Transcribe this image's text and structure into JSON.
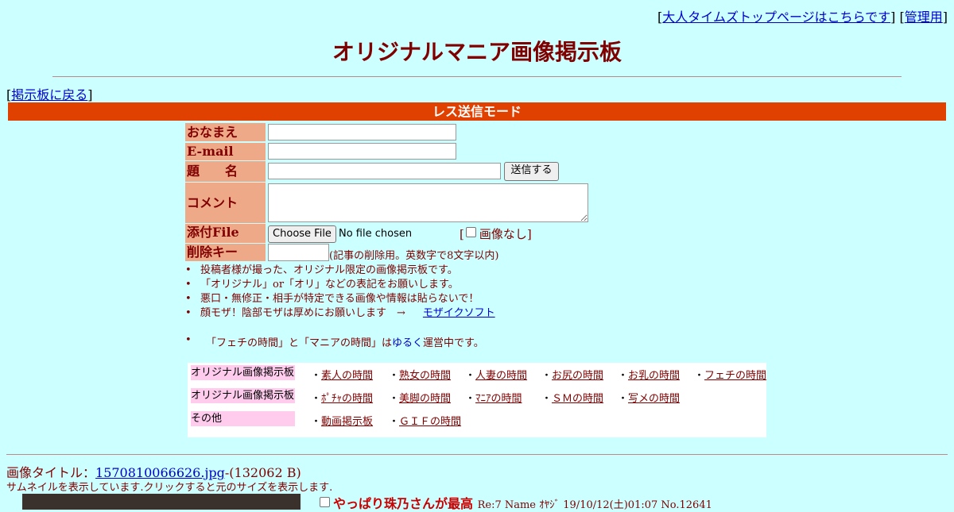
{
  "top_links": {
    "top_page": "大人タイムズトップページはこちらです",
    "admin": "管理用"
  },
  "page_title": "オリジナルマニア画像掲示板",
  "back_link": "掲示板に戻る",
  "mode_bar": "レス送信モード",
  "form": {
    "name_label": "おなまえ",
    "email_label": "E-mail",
    "subject_label": "題　　名",
    "submit_label": "送信する",
    "comment_label": "コメント",
    "file_label": "添付File",
    "choose_file_label": "Choose File",
    "no_file_text": "No file chosen",
    "no_image_label": "画像なし",
    "delete_key_label": "削除キー",
    "delete_key_note": "(記事の削除用。英数字で8文字以内)"
  },
  "notes": [
    "投稿者様が撮った、オリジナル限定の画像掲示板です。",
    "「オリジナル」or「オリ」などの表記をお願いします。",
    "悪口・無修正・相手が特定できる画像や情報は貼らないで！",
    "顔モザ！陰部モザは厚めにお願いします　→"
  ],
  "mosaic_link": "モザイクソフト",
  "operation_note": {
    "pre": "「フェチの時間」と「マニアの時間」は",
    "link": "ゆるく",
    "post": "運営中です。"
  },
  "nav": [
    {
      "head": "オリジナル画像掲示板",
      "links": [
        "素人の時間",
        "熟女の時間",
        "人妻の時間",
        "お尻の時間",
        "お乳の時間",
        "フェチの時間"
      ]
    },
    {
      "head": "オリジナル画像掲示板",
      "links": [
        "ﾎﾟﾁｬの時間",
        "美脚の時間",
        "ﾏﾆｱの時間",
        "ＳＭの時間",
        "写メの時間"
      ]
    },
    {
      "head": "その他",
      "links": [
        "動画掲示板",
        "ＧＩＦの時間"
      ]
    }
  ],
  "image_post": {
    "title_label": "画像タイトル：",
    "file_name": "1570810066626.jpg",
    "file_size": "-(132062 B)",
    "thumb_note": "サムネイルを表示しています.クリックすると元のサイズを表示します.",
    "post_title": "やっぱり珠乃さんが最高",
    "post_meta": "Re:7 Name ｵﾔｼﾞ 19/10/12(土)01:07 No.12641"
  },
  "colors": {
    "background": "#ccffff",
    "title": "#800000",
    "mode_bar": "#e04000",
    "label_bg": "#eeaa88",
    "nav_head_bg": "#ffccee"
  }
}
